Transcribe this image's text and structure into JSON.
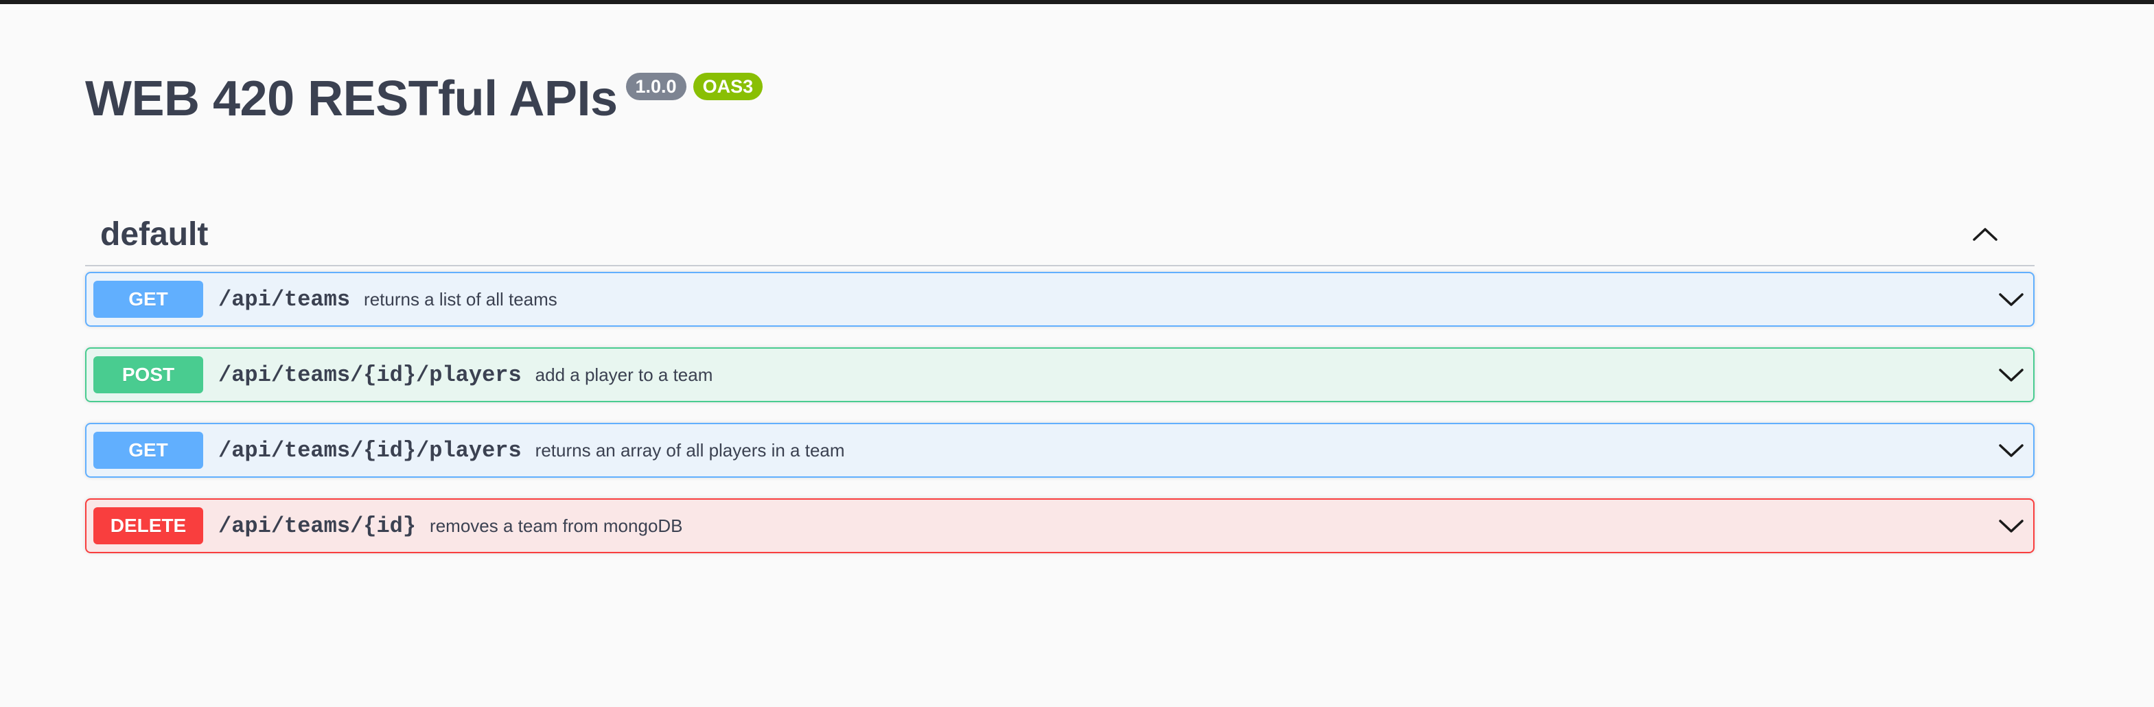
{
  "info": {
    "title": "WEB 420 RESTful APIs",
    "version": "1.0.0",
    "oas": "OAS3"
  },
  "tag": {
    "name": "default",
    "toggle_icon": "chevron-up-icon"
  },
  "operations": [
    {
      "method": "GET",
      "path": "/api/teams",
      "summary": "returns a list of all teams",
      "expand_icon": "chevron-down-icon"
    },
    {
      "method": "POST",
      "path": "/api/teams/{id}/players",
      "summary": "add a player to a team",
      "expand_icon": "chevron-down-icon"
    },
    {
      "method": "GET",
      "path": "/api/teams/{id}/players",
      "summary": "returns an array of all players in a team",
      "expand_icon": "chevron-down-icon"
    },
    {
      "method": "DELETE",
      "path": "/api/teams/{id}",
      "summary": "removes a team from mongoDB",
      "expand_icon": "chevron-down-icon"
    }
  ],
  "colors": {
    "get": "#61affe",
    "post": "#49cc90",
    "delete": "#f93e3e",
    "version_badge": "#7d8492",
    "oas_badge": "#89bf04",
    "text": "#3b4151"
  }
}
